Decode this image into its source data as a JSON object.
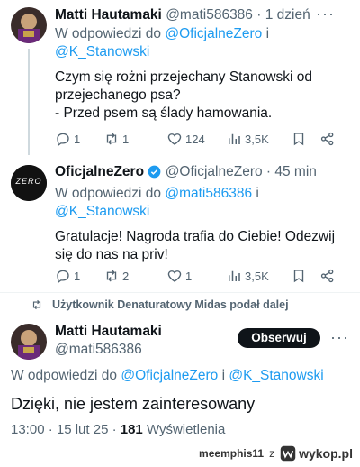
{
  "tweets": [
    {
      "name": "Matti Hautamaki",
      "handle": "@mati586386",
      "time": "· 1 dzień",
      "reply_prefix": "W odpowiedzi do",
      "reply_to_1": "@OficjalneZero",
      "reply_join": " i",
      "reply_to_2": "@K_Stanowski",
      "text": "Czym się rożni przejechany Stanowski od przejechanego psa?\n- Przed psem są ślady hamowania.",
      "replies": "1",
      "retweets": "1",
      "likes": "124",
      "views": "3,5K"
    },
    {
      "name": "OficjalneZero",
      "handle": "@OficjalneZero",
      "time": "· 45 min",
      "reply_prefix": "W odpowiedzi do",
      "reply_to_1": "@mati586386",
      "reply_join": " i",
      "reply_to_2": "@K_Stanowski",
      "text": "Gratulacje! Nagroda trafia do Ciebie! Odezwij się do nas na priv!",
      "replies": "1",
      "retweets": "2",
      "likes": "1",
      "views": "3,5K",
      "avatar_text": "ZERO"
    }
  ],
  "repost_note": "Użytkownik Denaturatowy Midas podał dalej",
  "main": {
    "name": "Matti Hautamaki",
    "handle": "@mati586386",
    "follow_label": "Obserwuj",
    "reply_prefix": "W odpowiedzi do",
    "reply_to_1": "@OficjalneZero",
    "reply_join": " i ",
    "reply_to_2": "@K_Stanowski",
    "text": "Dzięki, nie jestem zainteresowany",
    "time": "13:00 · 15 lut 25 ·",
    "views_count": "181",
    "views_label": "Wyświetlenia"
  },
  "watermark": {
    "user": "meemphis11",
    "sep": "z",
    "site": "wykop.pl"
  },
  "colors": {
    "link": "#1d9bf0",
    "muted": "#536471",
    "verified": "#1d9bf0",
    "accent_icon": "#1d9bf0"
  }
}
